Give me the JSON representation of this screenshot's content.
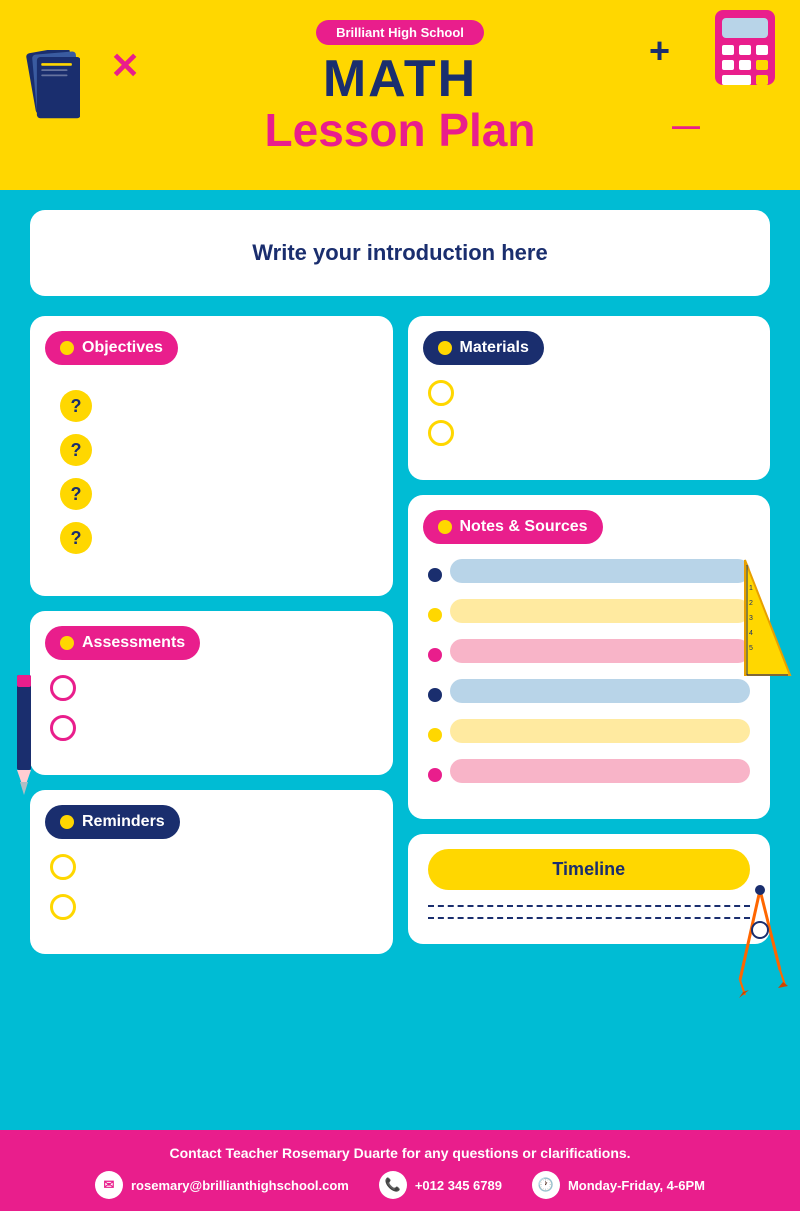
{
  "header": {
    "school_name": "Brilliant High School",
    "title_math": "MATH",
    "title_lesson": "Lesson Plan"
  },
  "intro": {
    "placeholder_text": "Write your introduction here"
  },
  "objectives": {
    "label": "Objectives",
    "items": [
      "?",
      "?",
      "?",
      "?"
    ]
  },
  "materials": {
    "label": "Materials",
    "items": [
      "",
      ""
    ]
  },
  "assessments": {
    "label": "Assessments",
    "items": [
      "",
      ""
    ]
  },
  "reminders": {
    "label": "Reminders",
    "items": [
      "",
      ""
    ]
  },
  "notes_sources": {
    "label": "Notes & Sources",
    "rows": [
      {
        "dot": "blue",
        "bar": "blue-light"
      },
      {
        "dot": "yellow",
        "bar": "yellow-light"
      },
      {
        "dot": "pink",
        "bar": "pink-light"
      },
      {
        "dot": "blue",
        "bar": "blue-light"
      },
      {
        "dot": "yellow",
        "bar": "yellow-light"
      },
      {
        "dot": "pink",
        "bar": "pink-light"
      }
    ]
  },
  "timeline": {
    "label": "Timeline",
    "lines": 2
  },
  "footer": {
    "contact_text": "Contact Teacher Rosemary Duarte for any questions or clarifications.",
    "email": "rosemary@brillianthighschool.com",
    "phone": "+012 345 6789",
    "hours": "Monday-Friday, 4-6PM"
  },
  "colors": {
    "yellow": "#FFD700",
    "pink": "#E91E8C",
    "blue_dark": "#1a2e6e",
    "cyan": "#00BCD4",
    "white": "#ffffff"
  }
}
